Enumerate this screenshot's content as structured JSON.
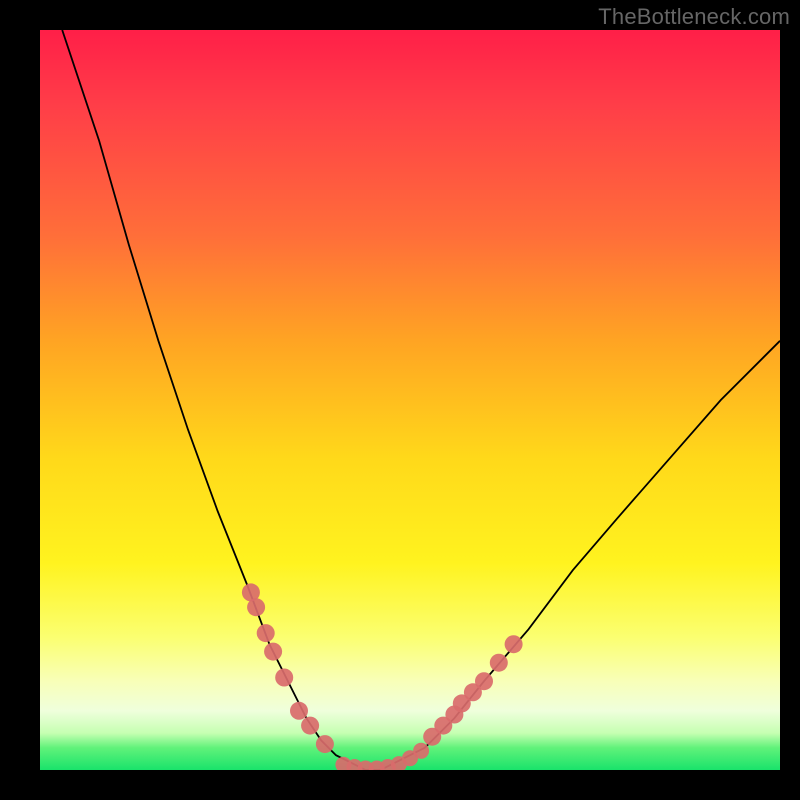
{
  "watermark": "TheBottleneck.com",
  "colors": {
    "frame_bg": "#000000",
    "bead": "#d96b6b",
    "curve": "#000000",
    "gradient_stops": [
      "#ff1f48",
      "#ff3d48",
      "#ff6f39",
      "#ffa423",
      "#ffd91a",
      "#fff31f",
      "#fbff70",
      "#f8ffb8",
      "#efffdc",
      "#c6ffb2",
      "#60f27a",
      "#19e36b"
    ]
  },
  "chart_data": {
    "type": "line",
    "title": "",
    "xlabel": "",
    "ylabel": "",
    "xlim": [
      0,
      100
    ],
    "ylim": [
      0,
      100
    ],
    "note": "Bottleneck curve: y≈0 (green) is optimal; higher y is worse. Tick labels are not shown in the original.",
    "series": [
      {
        "name": "bottleneck-curve",
        "x": [
          3,
          8,
          12,
          16,
          20,
          24,
          28,
          31,
          34,
          36,
          38,
          40,
          42,
          44,
          46,
          48,
          52,
          56,
          60,
          66,
          72,
          78,
          85,
          92,
          100
        ],
        "y": [
          100,
          85,
          71,
          58,
          46,
          35,
          25,
          17,
          11,
          7,
          4,
          2,
          1,
          0,
          0,
          1,
          3,
          7,
          12,
          19,
          27,
          34,
          42,
          50,
          58
        ]
      }
    ],
    "beads_left": {
      "name": "left-cluster",
      "x": [
        28.5,
        29.2,
        30.5,
        31.5,
        33.0,
        35.0,
        36.5,
        38.5
      ],
      "y": [
        24.0,
        22.0,
        18.5,
        16.0,
        12.5,
        8.0,
        6.0,
        3.5
      ]
    },
    "beads_valley": {
      "name": "valley-cluster",
      "x": [
        41.0,
        42.5,
        44.0,
        45.5,
        47.0,
        48.5,
        50.0,
        51.5
      ],
      "y": [
        0.7,
        0.4,
        0.2,
        0.2,
        0.4,
        0.8,
        1.6,
        2.6
      ]
    },
    "beads_right": {
      "name": "right-cluster",
      "x": [
        53.0,
        54.5,
        56.0,
        57.0,
        58.5,
        60.0,
        62.0,
        64.0
      ],
      "y": [
        4.5,
        6.0,
        7.5,
        9.0,
        10.5,
        12.0,
        14.5,
        17.0
      ]
    }
  }
}
